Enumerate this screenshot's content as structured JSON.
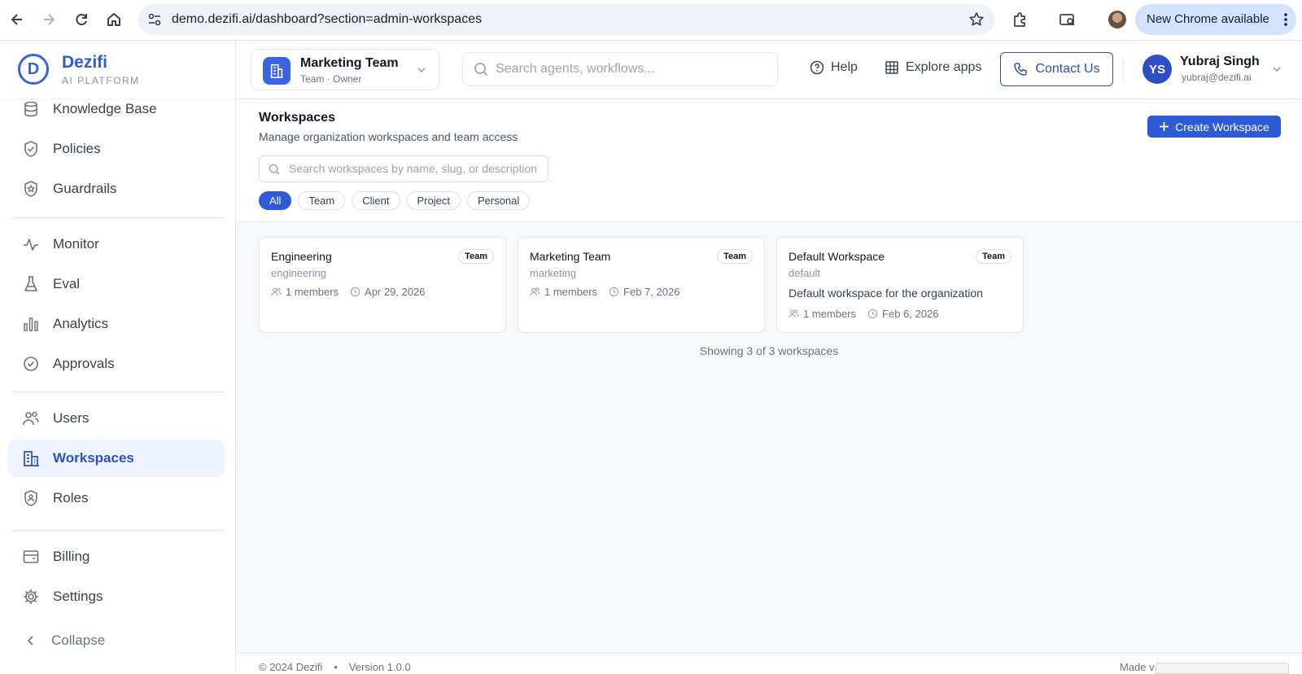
{
  "browser": {
    "url": "demo.dezifi.ai/dashboard?section=admin-workspaces",
    "update_label": "New Chrome available"
  },
  "brand": {
    "name": "Dezifi",
    "subtitle": "AI PLATFORM",
    "logo_letter": "D"
  },
  "sidebar": {
    "items": [
      {
        "label": "Knowledge Base",
        "icon": "database-icon"
      },
      {
        "label": "Policies",
        "icon": "shield-check-icon"
      },
      {
        "label": "Guardrails",
        "icon": "shield-star-icon"
      },
      {
        "label": "Monitor",
        "icon": "activity-icon"
      },
      {
        "label": "Eval",
        "icon": "flask-icon"
      },
      {
        "label": "Analytics",
        "icon": "bar-chart-icon"
      },
      {
        "label": "Approvals",
        "icon": "check-circle-icon"
      },
      {
        "label": "Users",
        "icon": "users-icon"
      },
      {
        "label": "Workspaces",
        "icon": "building-icon",
        "active": true
      },
      {
        "label": "Roles",
        "icon": "shield-user-icon"
      },
      {
        "label": "Billing",
        "icon": "wallet-icon"
      },
      {
        "label": "Settings",
        "icon": "gear-icon"
      }
    ],
    "collapse_label": "Collapse"
  },
  "header": {
    "team_name": "Marketing Team",
    "team_role": "Team · Owner",
    "search_placeholder": "Search agents, workflows...",
    "help_label": "Help",
    "explore_label": "Explore apps",
    "contact_label": "Contact Us",
    "user": {
      "initials": "YS",
      "name": "Yubraj Singh",
      "email": "yubraj@dezifi.ai"
    }
  },
  "page": {
    "title": "Workspaces",
    "subtitle": "Manage organization workspaces and team access",
    "create_label": "Create Workspace",
    "search_placeholder": "Search workspaces by name, slug, or description",
    "filters": [
      "All",
      "Team",
      "Client",
      "Project",
      "Personal"
    ],
    "active_filter": "All",
    "workspaces": [
      {
        "name": "Engineering",
        "slug": "engineering",
        "badge": "Team",
        "description": "",
        "members": "1 members",
        "date": "Apr 29, 2026"
      },
      {
        "name": "Marketing Team",
        "slug": "marketing",
        "badge": "Team",
        "description": "",
        "members": "1 members",
        "date": "Feb 7, 2026"
      },
      {
        "name": "Default Workspace",
        "slug": "default",
        "badge": "Team",
        "description": "Default workspace for the organization",
        "members": "1 members",
        "date": "Feb 6, 2026"
      }
    ],
    "showing_text": "Showing 3 of 3 workspaces"
  },
  "footer": {
    "copyright": "© 2024 Dezifi",
    "bullet": "•",
    "version": "Version 1.0.0",
    "made": "Made v"
  },
  "colors": {
    "accent": "#2d5bd7",
    "active_bg": "#eef4ff"
  }
}
